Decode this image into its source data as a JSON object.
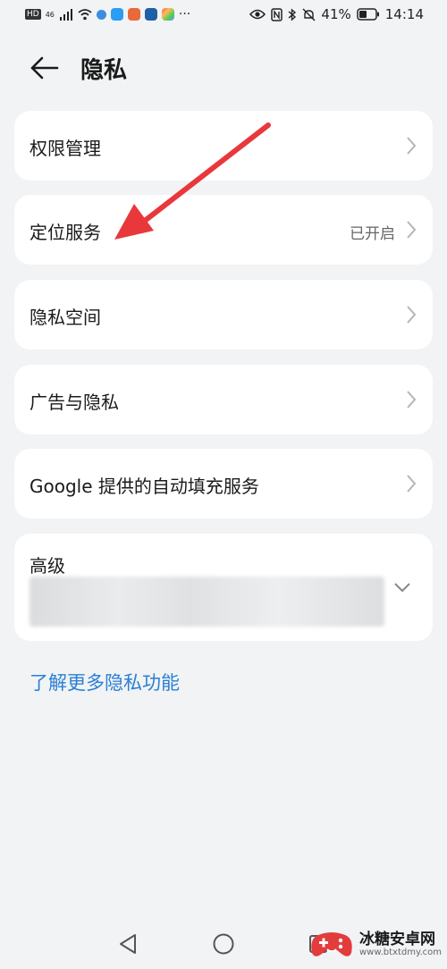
{
  "status_bar": {
    "left_label": "HD",
    "signal": "46",
    "more": "···",
    "battery": "41%",
    "time": "14:14",
    "icons": [
      "signal-icon",
      "wifi-icon",
      "app-icons",
      "eye-icon",
      "nfc-icon",
      "bluetooth-icon",
      "mute-icon",
      "battery-icon"
    ]
  },
  "header": {
    "title": "隐私",
    "back_icon": "back-arrow-icon"
  },
  "items": [
    {
      "label": "权限管理",
      "value": ""
    },
    {
      "label": "定位服务",
      "value": "已开启"
    },
    {
      "label": "隐私空间",
      "value": ""
    },
    {
      "label": "广告与隐私",
      "value": ""
    },
    {
      "label": "Google 提供的自动填充服务",
      "value": ""
    }
  ],
  "advanced": {
    "label": "高级",
    "icon": "chevron-down-icon"
  },
  "learn_more": "了解更多隐私功能",
  "watermark": {
    "main": "冰糖安卓网",
    "sub": "www.btxtdmy.com"
  },
  "colors": {
    "link": "#2a7fd4",
    "annotation_arrow": "#e8383b",
    "background": "#f1f3f5"
  }
}
